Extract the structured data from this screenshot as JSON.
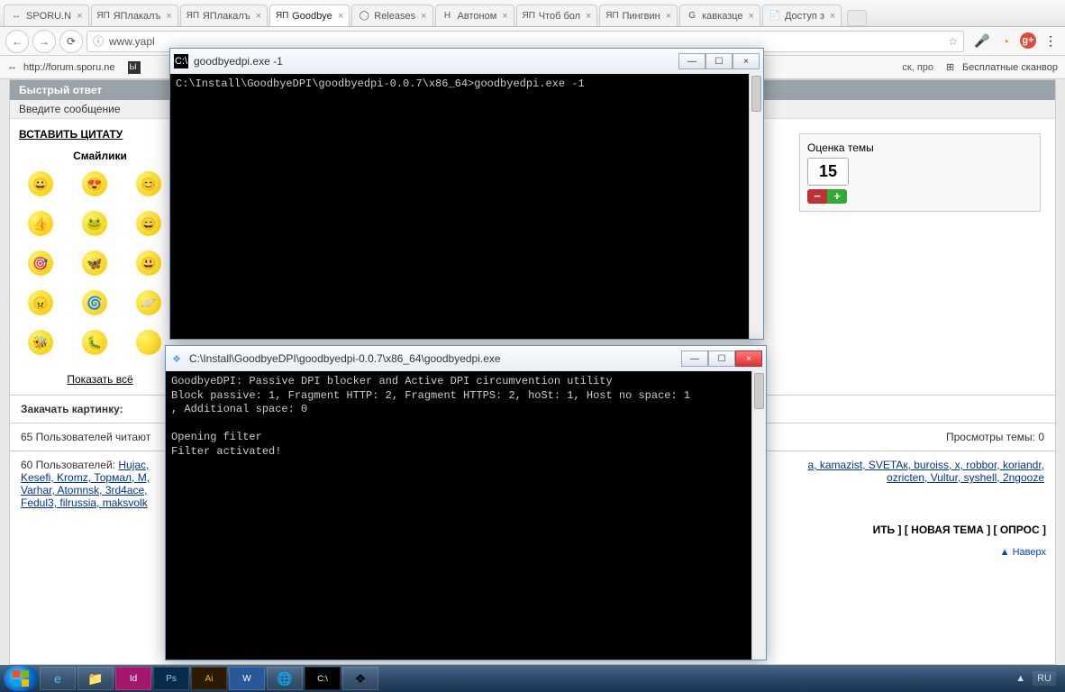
{
  "tabs": [
    {
      "label": "SPORU.N",
      "icon": "↔"
    },
    {
      "label": "ЯПлакалъ",
      "icon": "ЯП"
    },
    {
      "label": "ЯПлакалъ",
      "icon": "ЯП"
    },
    {
      "label": "Goodbye",
      "icon": "ЯП",
      "active": true
    },
    {
      "label": "Releases",
      "icon": "◯"
    },
    {
      "label": "Автоном",
      "icon": "H"
    },
    {
      "label": "Чтоб бол",
      "icon": "ЯП"
    },
    {
      "label": "Пингвин",
      "icon": "ЯП"
    },
    {
      "label": "кавказце",
      "icon": "G"
    },
    {
      "label": "Доступ з",
      "icon": "📄"
    }
  ],
  "url": "www.yapl",
  "url_suffix_hidden": "ск, про",
  "bookmarks": [
    {
      "label": "http://forum.sporu.ne",
      "icon": "↔"
    },
    {
      "label": "",
      "icon": "Ы"
    },
    {
      "label": "Бесплатные сканвор",
      "icon": "⊞"
    }
  ],
  "bookmark_glyph": "☆",
  "forum": {
    "quick_reply": "Быстрый ответ",
    "enter_msg": "Введите сообщение",
    "insert_quote": "ВСТАВИТЬ ЦИТАТУ",
    "smilies_head": "Смайлики",
    "show_all": "Показать всё",
    "rating_label": "Оценка темы",
    "rating_value": "15",
    "upload_label": "Закачать картинку:",
    "readers_line": "65 Пользователей читают",
    "views": "Просмотры темы: 0",
    "users_prefix": "60 Пользователей: ",
    "users_left": "Hujac, Kesefi, Kromz, Тормал, M, Varhar, Atomnsk, 3rd4ace, Fedul3, filrussia, maksvolk",
    "users_right": "a, kamazist, SVETAк, buroiss, x, robbor, koriandr, ozricten, Vultur, syshell, 2ngooze",
    "actions": "ИТЬ ] [ НОВАЯ ТЕМА ] [ ОПРОС ]",
    "top": "▲ Наверх"
  },
  "console1": {
    "title": "goodbyedpi.exe -1",
    "line": "C:\\Install\\GoodbyeDPI\\goodbyedpi-0.0.7\\x86_64>goodbyedpi.exe -1"
  },
  "console2": {
    "title": "C:\\Install\\GoodbyeDPI\\goodbyedpi-0.0.7\\x86_64\\goodbyedpi.exe",
    "body": "GoodbyeDPI: Passive DPI blocker and Active DPI circumvention utility\nBlock passive: 1, Fragment HTTP: 2, Fragment HTTPS: 2, hoSt: 1, Host no space: 1\n, Additional space: 0\n\nOpening filter\nFilter activated!"
  },
  "tray": {
    "lang": "RU"
  },
  "glyphs": {
    "close": "×",
    "min": "—",
    "max": "☐",
    "back": "←",
    "fwd": "→",
    "reload": "⟳",
    "info": "ⓘ",
    "star": "☆",
    "mic": "🎤",
    "gplus": "g+",
    "menu": "⋮",
    "flag": "▲"
  }
}
